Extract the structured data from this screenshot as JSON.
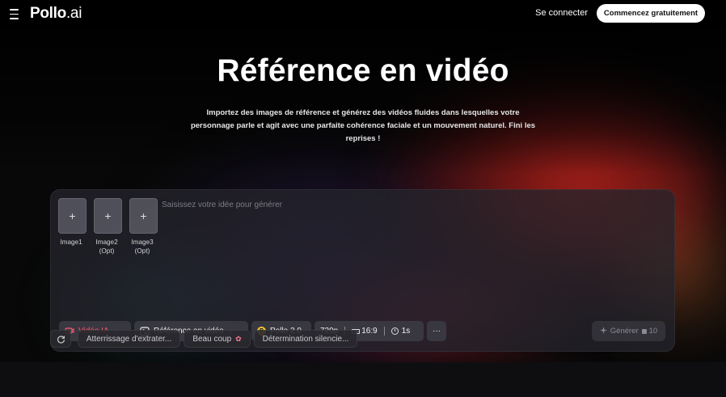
{
  "header": {
    "logo_main": "Pollo",
    "logo_suffix": ".ai",
    "login_label": "Se connecter",
    "start_label": "Commencez gratuitement"
  },
  "hero": {
    "title": "Référence en vidéo",
    "subtitle": "Importez des images de référence et générez des vidéos fluides dans lesquelles votre personnage parle et agit avec une parfaite cohérence faciale et un mouvement naturel. Fini les reprises !"
  },
  "composer": {
    "slots": [
      {
        "plus": "+",
        "label": "Image1"
      },
      {
        "plus": "+",
        "label": "Image2\n(Opt)"
      },
      {
        "plus": "+",
        "label": "Image3\n(Opt)"
      }
    ],
    "prompt_placeholder": "Saisissez votre idée pour générer",
    "toolbar": {
      "mode_label": "Vidéo IA",
      "type_label": "Référence en vidéo",
      "model_label": "Pollo 2.0",
      "model_icon_letter": "P",
      "resolution": "720p",
      "ratio": "16:9",
      "duration": "1s",
      "more_label": "···"
    },
    "generate_label": "Générer",
    "credits": "10"
  },
  "suggestions": {
    "chips": [
      "Atterrissage d'extrater...",
      "Beau coup",
      "Détermination silencie..."
    ]
  },
  "colors": {
    "accent_red": "#ff5a6e",
    "background": "#0b0b0d",
    "start_button_bg": "#ffffff"
  }
}
